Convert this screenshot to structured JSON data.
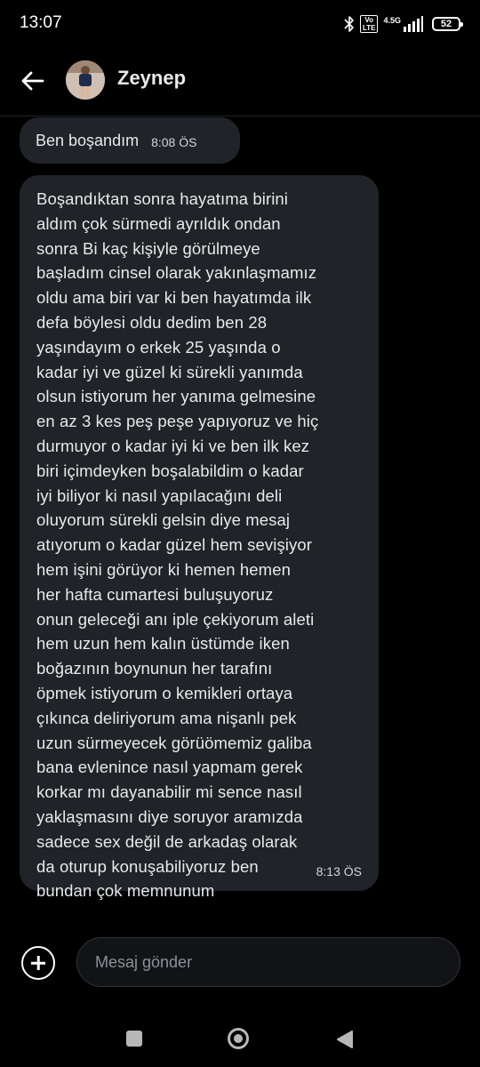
{
  "status_bar": {
    "time": "13:07",
    "volte_label": "Vo\nLTE",
    "network_label": "4.5G",
    "battery": "52"
  },
  "header": {
    "contact_name": "Zeynep",
    "back_icon": "arrow-left-icon"
  },
  "messages": [
    {
      "text": "Ben boşandım",
      "time": "8:08 ÖS"
    },
    {
      "text": "Boşandıktan sonra hayatıma birini\naldım çok sürmedi ayrıldık ondan\nsonra Bi kaç kişiyle görülmeye\nbaşladım cinsel olarak yakınlaşmamız\noldu ama biri var ki ben hayatımda ilk\ndefa böylesi oldu dedim ben 28\nyaşındayım o erkek 25 yaşında o\nkadar iyi ve güzel ki sürekli yanımda\nolsun istiyorum her yanıma gelmesine\nen az 3 kes peş peşe yapıyoruz ve hiç\ndurmuyor o kadar iyi ki ve ben ilk kez\nbiri içimdeyken boşalabildim o kadar\niyi biliyor ki nasıl yapılacağını deli\noluyorum sürekli gelsin diye mesaj\natıyorum o kadar güzel hem sevişiyor\nhem işini görüyor ki hemen hemen\nher hafta cumartesi buluşuyoruz\nonun geleceği anı iple çekiyorum aleti\nhem uzun hem kalın üstümde iken\nboğazının boynunun her tarafını\nöpmek istiyorum o kemikleri ortaya\nçıkınca deliriyorum ama nişanlı pek\nuzun sürmeyecek görüömemiz galiba\nbana evlenince nasıl yapmam gerek\nkorkar mı dayanabilir mi sence nasıl\nyaklaşmasını diye soruyor aramızda\nsadece sex değil de arkadaş olarak\nda oturup konuşabiliyoruz ben\nbundan çok memnunum",
      "time": "8:13 ÖS"
    }
  ],
  "composer": {
    "placeholder": "Mesaj gönder",
    "value": ""
  },
  "colors": {
    "background": "#000000",
    "bubble": "#202327",
    "text": "#e7e9ea"
  }
}
